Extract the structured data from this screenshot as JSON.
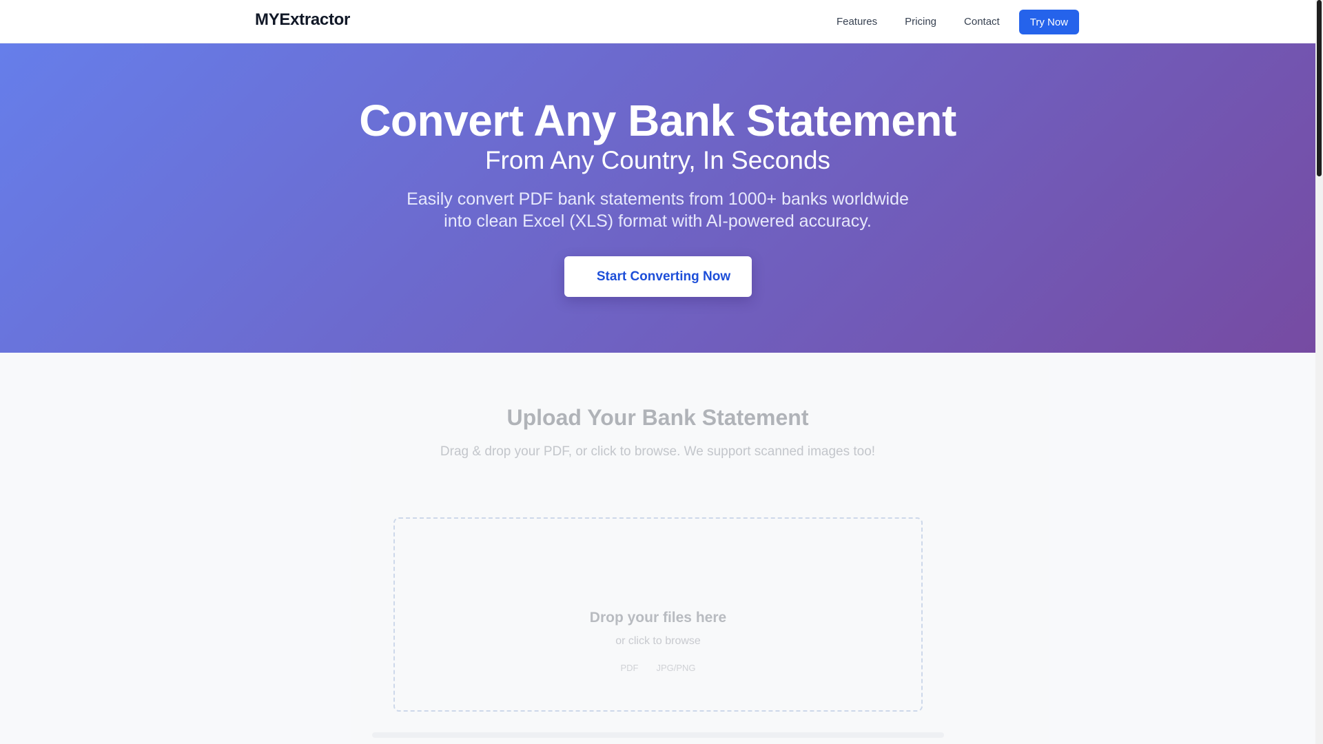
{
  "header": {
    "logo": "MYExtractor",
    "nav": [
      "Features",
      "Pricing",
      "Contact"
    ],
    "cta_label": "Try Now"
  },
  "hero": {
    "title": "Convert Any Bank Statement",
    "subtitle": "From Any Country, In Seconds",
    "description_line1": "Easily convert PDF bank statements from 1000+ banks worldwide",
    "description_line2": "into clean Excel (XLS) format with AI-powered accuracy.",
    "cta_label": "Start Converting Now"
  },
  "upload": {
    "title": "Upload Your Bank Statement",
    "subtitle": "Drag & drop your PDF, or click to browse. We support scanned images too!",
    "dropzone_title": "Drop your files here",
    "dropzone_sub": "or click to browse",
    "formats": [
      "PDF",
      "JPG/PNG"
    ]
  },
  "colors": {
    "primary": "#2563eb",
    "gradient_start": "#667eea",
    "gradient_end": "#764ba2"
  }
}
